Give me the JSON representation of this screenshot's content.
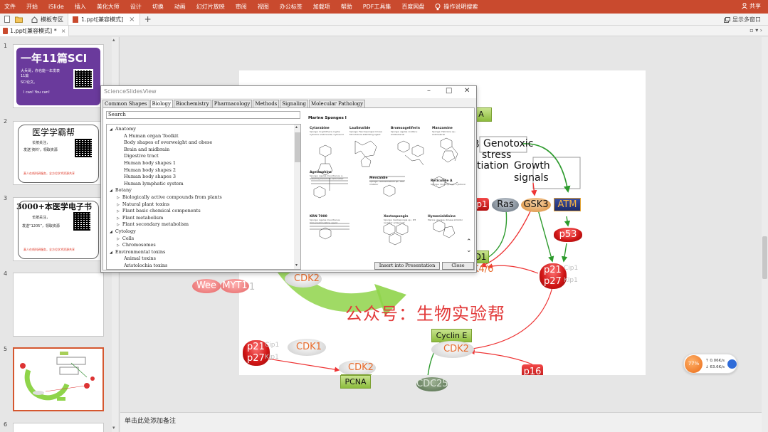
{
  "ribbon": {
    "menu": [
      "文件",
      "开始",
      "iSlide",
      "插入",
      "美化大师",
      "设计",
      "切换",
      "动画",
      "幻灯片放映",
      "审阅",
      "视图",
      "办公标签",
      "加载项",
      "帮助",
      "PDF工具集",
      "百度网盘"
    ],
    "tell_me": "操作说明搜索",
    "share": "共享"
  },
  "doc_tabs": {
    "template_tab": "模板专区",
    "doc_tab": "1.ppt[兼容模式]",
    "multi_window": "显示多窗口"
  },
  "file_tab": "1.ppt[兼容模式] *",
  "thumbnails": {
    "numbers": [
      "1",
      "2",
      "3",
      "4",
      "5",
      "6"
    ],
    "slide1": {
      "title": "一年11篇SCI",
      "line1": "大兵哥，你也能一年发表11篇",
      "line2": "SCI论文。",
      "line3": "I can! You can!"
    },
    "slide2": {
      "title": "医学学霸帮",
      "line1": "长按关注，",
      "line2": "发送'资料'，领取资源",
      "line3": "真人在线科研服务，全方位学术资源共享"
    },
    "slide3": {
      "title": "3000+本医学电子书",
      "line1": "长按关注，",
      "line2": "发送“1205”，领取资源",
      "line3": "真人在线科研服务，全方位学术资源共享"
    }
  },
  "notes_placeholder": "单击此处添加备注",
  "slide": {
    "labels": {
      "genotoxic": "Genotoxic",
      "stress": "stress",
      "tiation": "tiation",
      "growth": "Growth",
      "signals": "signals",
      "ras": "Ras",
      "gsk3": "GSK3",
      "atm": "ATM",
      "p53": "p53",
      "p21": "p21",
      "p27": "p27",
      "cip1": "Cip1",
      "kip1": "Kip1",
      "p1": "p1",
      "k46": "K4/6",
      "d1": "D1",
      "a": "A",
      "b": "B",
      "cdk2": "CDK2",
      "cdk1": "CDK1",
      "cyclin_e": "Cyclin E",
      "pcna": "PCNA",
      "cdc25": "CDC25",
      "p16": "p16",
      "wee": "Wee",
      "myt1": "MYT1",
      "one": "1"
    },
    "watermark": "公众号：生物实验帮"
  },
  "dialog": {
    "title": "ScienceSlidesView",
    "tabs": [
      "Common Shapes",
      "Biology",
      "Biochemistry",
      "Pharmacology",
      "Methods",
      "Signaling",
      "Molecular Pathology"
    ],
    "active_tab": "Biology",
    "search_label": "Search",
    "tree": [
      {
        "label": "Anatomy",
        "expander": "◢",
        "indent": 0
      },
      {
        "label": "A Human organ Toolkit",
        "indent": 2
      },
      {
        "label": "Body shapes of overweight and obese",
        "indent": 2
      },
      {
        "label": "Brain and midbrain",
        "indent": 2
      },
      {
        "label": "Digestive tract",
        "indent": 2
      },
      {
        "label": "Human body shapes 1",
        "indent": 2
      },
      {
        "label": "Human body shapes 2",
        "indent": 2
      },
      {
        "label": "Human body shapes 3",
        "indent": 2
      },
      {
        "label": "Human lymphatic system",
        "indent": 2
      },
      {
        "label": "Botany",
        "expander": "◢",
        "indent": 0
      },
      {
        "label": "Biologically active compounds from plants",
        "expander": "▷",
        "indent": 1
      },
      {
        "label": "Natural plant toxins",
        "expander": "▷",
        "indent": 1
      },
      {
        "label": "Plant basic chemical components",
        "expander": "▷",
        "indent": 1
      },
      {
        "label": "Plant metabolism",
        "expander": "▷",
        "indent": 1
      },
      {
        "label": "Plant secondary metabolism",
        "expander": "▷",
        "indent": 1
      },
      {
        "label": "Cytology",
        "expander": "◢",
        "indent": 0
      },
      {
        "label": "Cells",
        "expander": "▷",
        "indent": 1
      },
      {
        "label": "Chromosomes",
        "expander": "▷",
        "indent": 1
      },
      {
        "label": "Environmental toxins",
        "expander": "◢",
        "indent": 0
      },
      {
        "label": "Animal toxins",
        "indent": 2
      },
      {
        "label": "Aristolochia toxins",
        "indent": 2
      }
    ],
    "preview": {
      "title": "Marine Sponges I",
      "molecules": [
        {
          "name": "Cytarabine",
          "desc": "Sponge: Cryptotheca crypta; Cytosine arabinoside; Cytosar-U"
        },
        {
          "name": "Laulimalide",
          "desc": "Sponge: Fasciospongia rimosa; Microtubule-stabilizing agent"
        },
        {
          "name": "Bromoageliferin",
          "desc": "Sponge: Agelas conifera; Antibacterial"
        },
        {
          "name": "Manzamine",
          "desc": "Sponge: Haliclona sp.; Antimalarial"
        },
        {
          "name": "Agelasphins",
          "desc": "Sponge: Agelas mauritianus; α-Galactosylceramide; anti-tumor"
        },
        {
          "name": "Mevcaldie",
          "desc": "Sponge: Leiodermatium sp.; PKC inhibitor"
        },
        {
          "name": "Reticulide A",
          "desc": "Sponge: Cinachyra sp.; cytotoxic"
        },
        {
          "name": "KRN 7000",
          "desc": "Sponge: Agelas mauritianus; Immunostimulating agent"
        },
        {
          "name": "Xestospongin",
          "desc": "Sponge: Xestospongia sp.; IP3 receptor antagonist"
        },
        {
          "name": "Hymenialdisine",
          "desc": "Marine sponges; Kinase inhibitor"
        }
      ]
    },
    "buttons": {
      "insert": "Insert into Presentation",
      "close": "Close"
    }
  },
  "net_widget": {
    "percent": "77%",
    "up": "0.06K/s",
    "down": "63.6K/s"
  }
}
